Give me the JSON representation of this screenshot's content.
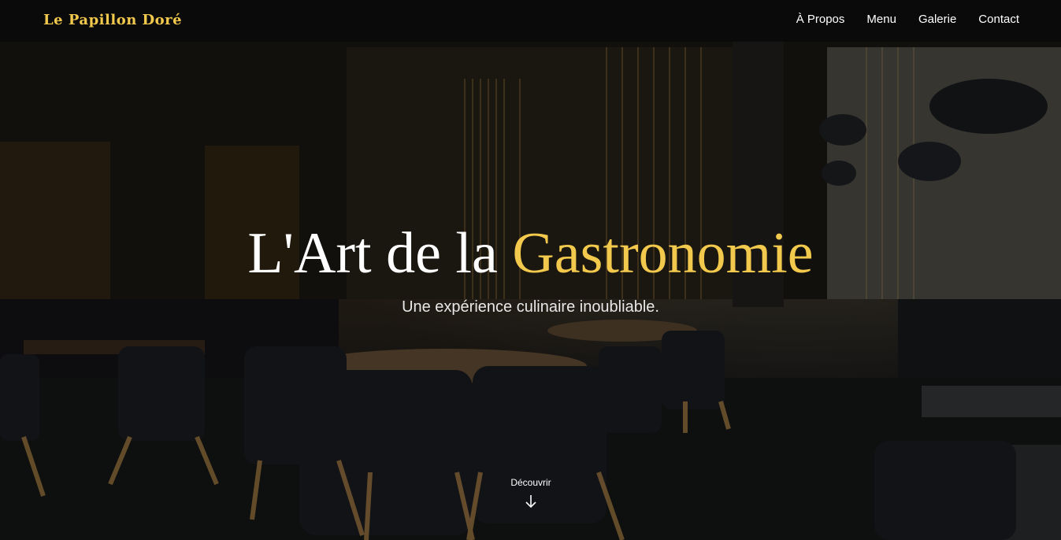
{
  "brand": "Le Papillon Doré",
  "nav": {
    "items": [
      "À Propos",
      "Menu",
      "Galerie",
      "Contact"
    ]
  },
  "hero": {
    "title_part1": "L'Art de la ",
    "title_accent": "Gastronomie",
    "subtitle": "Une expérience culinaire inoubliable.",
    "cta_label": "Découvrir",
    "background": "restaurant-interior-photo"
  },
  "colors": {
    "accent": "#f2c94c",
    "navbar_bg": "#0a0a0a",
    "text": "#ffffff"
  },
  "icons": {
    "scroll": "arrow-down-icon"
  }
}
